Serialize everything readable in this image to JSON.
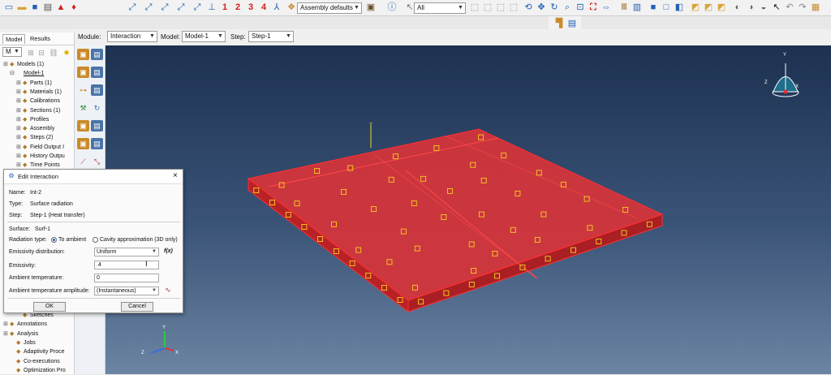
{
  "toolbar": {
    "view_numbers": [
      "1",
      "2",
      "3",
      "4"
    ],
    "render_style": "Assembly defaults",
    "filter": "All"
  },
  "context": {
    "module_label": "Module:",
    "module_value": "Interaction",
    "model_label": "Model:",
    "model_value": "Model-1",
    "step_label": "Step:",
    "step_value": "Step-1"
  },
  "tree": {
    "tabs": [
      "Model",
      "Results"
    ],
    "filter_value": "M",
    "items": [
      {
        "label": "Models (1)",
        "indent": 0,
        "icon": "models-icon"
      },
      {
        "label": "Model-1",
        "indent": 1,
        "icon": ""
      },
      {
        "label": "Parts (1)",
        "indent": 2,
        "icon": "parts-icon"
      },
      {
        "label": "Materials (1)",
        "indent": 2,
        "icon": "materials-icon"
      },
      {
        "label": "Calibrations",
        "indent": 2,
        "icon": "calibrations-icon"
      },
      {
        "label": "Sections (1)",
        "indent": 2,
        "icon": "sections-icon"
      },
      {
        "label": "Profiles",
        "indent": 2,
        "icon": "profiles-icon"
      },
      {
        "label": "Assembly",
        "indent": 2,
        "icon": "assembly-icon"
      },
      {
        "label": "Steps (2)",
        "indent": 2,
        "icon": "steps-icon"
      },
      {
        "label": "Field Output I",
        "indent": 2,
        "icon": "field-output-icon"
      },
      {
        "label": "History Outpu",
        "indent": 2,
        "icon": "history-output-icon"
      },
      {
        "label": "Time Points",
        "indent": 2,
        "icon": "time-points-icon"
      }
    ],
    "bottom_items": [
      {
        "label": "Sketches",
        "indent": 2
      },
      {
        "label": "Annotations",
        "indent": 0
      },
      {
        "label": "Analysis",
        "indent": 0
      },
      {
        "label": "Jobs",
        "indent": 1
      },
      {
        "label": "Adaptivity Proce",
        "indent": 1
      },
      {
        "label": "Co-executions",
        "indent": 1
      },
      {
        "label": "Optimization Pro",
        "indent": 1
      }
    ]
  },
  "dialog": {
    "title": "Edit Interaction",
    "close": "×",
    "name_label": "Name:",
    "name_value": "Int-2",
    "type_label": "Type:",
    "type_value": "Surface radiation",
    "step_label": "Step:",
    "step_value": "Step-1 (Heat transfer)",
    "surface_label": "Surface:",
    "surface_value": "Surf-1",
    "radiation_type_label": "Radiation type:",
    "radiation_option_ambient": "To ambient",
    "radiation_option_cavity": "Cavity approximation (3D only)",
    "emissivity_dist_label": "Emissivity distribution:",
    "emissivity_dist_value": "Uniform",
    "fx_label": "f(x)",
    "emissivity_label": "Emissivity:",
    "emissivity_value": ".4",
    "ambient_temp_label": "Ambient temperature:",
    "ambient_temp_value": "0",
    "amplitude_label": "Ambient temperature amplitude:",
    "amplitude_value": "(Instantaneous)",
    "ok_label": "OK",
    "cancel_label": "Cancel"
  },
  "viewport": {
    "axis_labels": {
      "x": "X",
      "y": "Y",
      "z": "Z"
    },
    "plate_color": "#e03434",
    "marker_color": "#f2d21c"
  }
}
